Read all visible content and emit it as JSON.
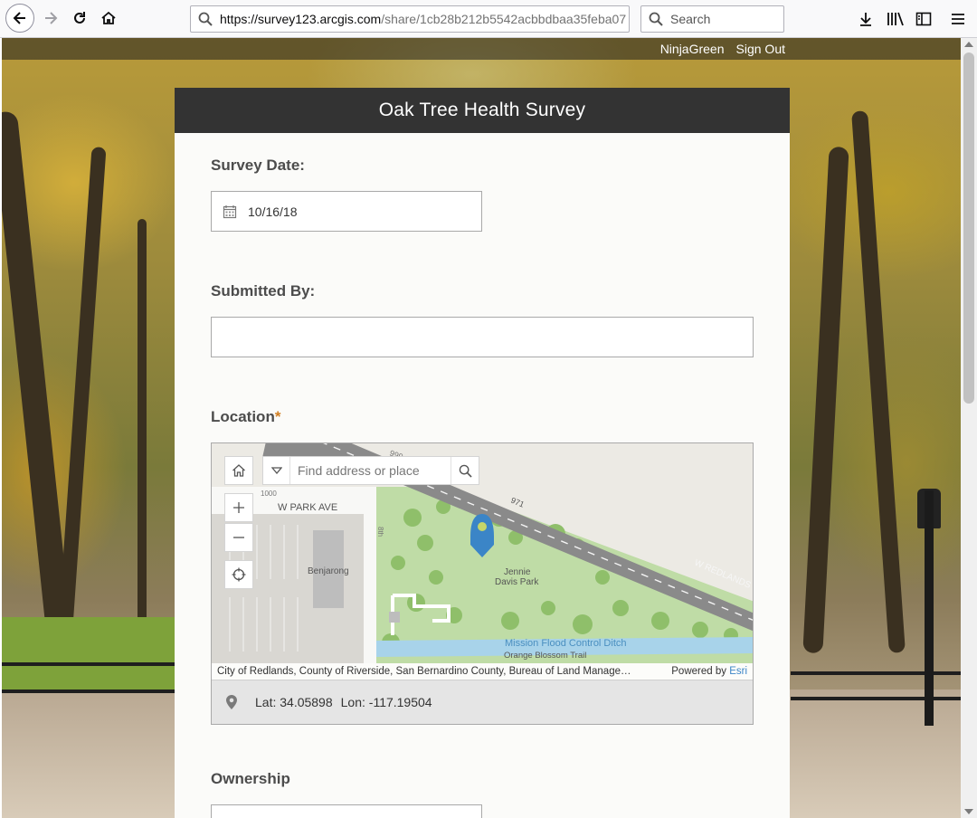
{
  "browser": {
    "url_host": "https://survey123.arcgis.com",
    "url_path": "/share/1cb28b212b5542acbbdbaa35feba07",
    "search_placeholder": "Search"
  },
  "userbar": {
    "username": "NinjaGreen",
    "sign_out": "Sign Out"
  },
  "survey": {
    "title": "Oak Tree Health Survey",
    "date_label": "Survey Date:",
    "date_value": "10/16/18",
    "submitted_label": "Submitted By:",
    "submitted_value": "",
    "location_label": "Location",
    "required_mark": "*",
    "ownership_label": "Ownership"
  },
  "map": {
    "search_placeholder": "Find address or place",
    "labels": {
      "street_park": "W PARK AVE",
      "street_redlands": "W REDLANDS",
      "route_999": "999",
      "route_971": "971",
      "route_1000": "1000",
      "lot_n": "8th",
      "place_benjarong": "Benjarong",
      "park_line1": "Jennie",
      "park_line2": "Davis Park",
      "ditch": "Mission Flood Control Ditch",
      "trail": "Orange Blossom Trail"
    },
    "attribution": "City of Redlands, County of Riverside, San Bernardino County, Bureau of Land Manage…",
    "powered_by": "Powered by ",
    "esri": "Esri",
    "lat_text": "Lat: 34.05898",
    "lon_text": "Lon: -117.19504",
    "colors": {
      "park": "#bfdca6",
      "road": "#8a8a8a",
      "water": "#a8d3ea",
      "pin": "#3b85c7"
    }
  }
}
